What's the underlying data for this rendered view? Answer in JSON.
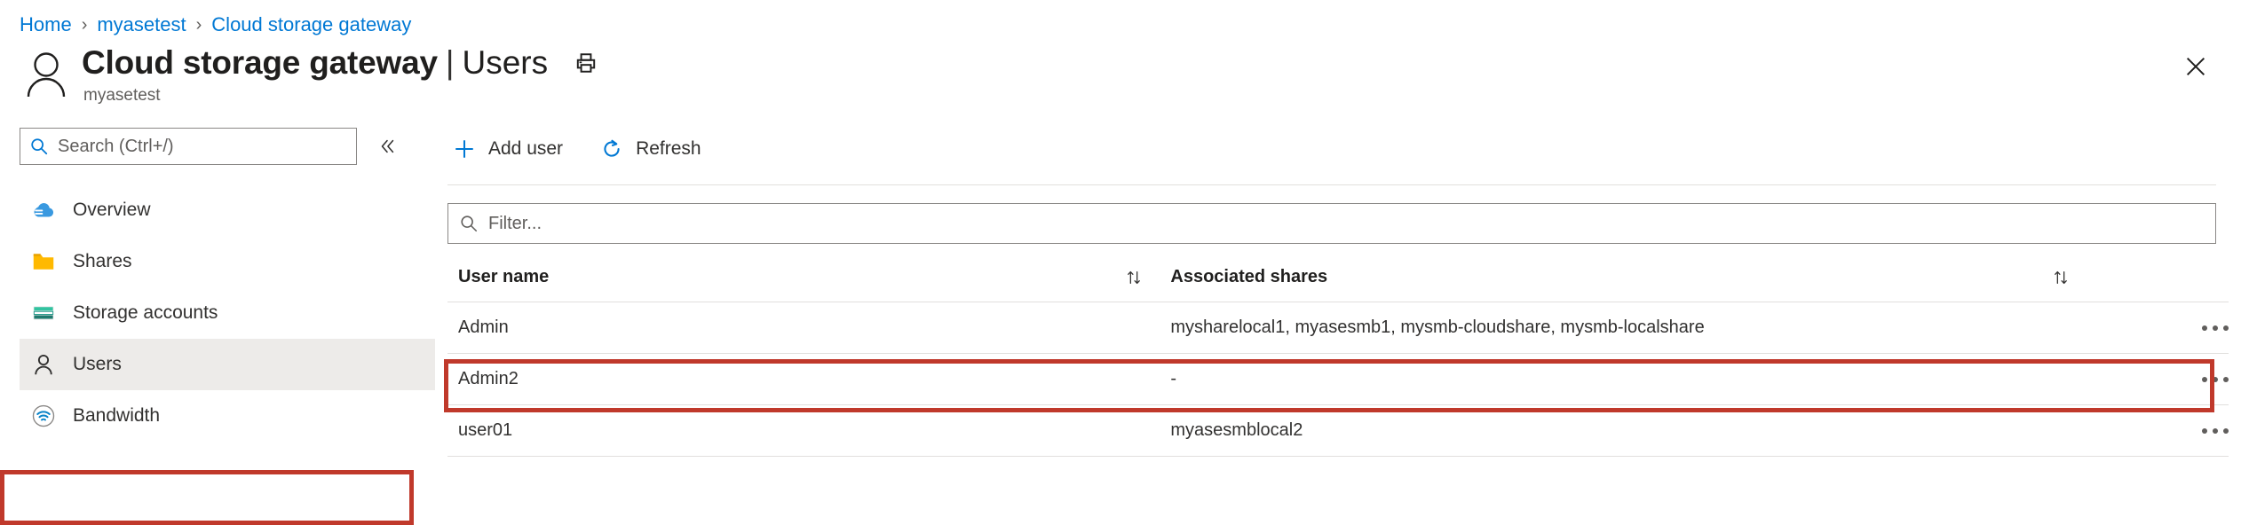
{
  "breadcrumb": {
    "items": [
      {
        "label": "Home"
      },
      {
        "label": "myasetest"
      },
      {
        "label": "Cloud storage gateway"
      }
    ],
    "separator": "›"
  },
  "header": {
    "resource_icon": "person-icon",
    "title": "Cloud storage gateway",
    "title_separator": "|",
    "section": "Users",
    "subtitle": "myasetest",
    "print_icon": "printer-icon",
    "close_icon": "close-icon"
  },
  "sidebar": {
    "search": {
      "placeholder": "Search (Ctrl+/)",
      "value": "",
      "icon": "search-icon"
    },
    "collapse_icon": "chevron-double-left-icon",
    "items": [
      {
        "label": "Overview",
        "icon": "cloud-icon",
        "selected": false
      },
      {
        "label": "Shares",
        "icon": "folder-icon",
        "selected": false
      },
      {
        "label": "Storage accounts",
        "icon": "storage-icon",
        "selected": false
      },
      {
        "label": "Users",
        "icon": "person-icon",
        "selected": true
      },
      {
        "label": "Bandwidth",
        "icon": "bandwidth-icon",
        "selected": false
      }
    ]
  },
  "toolbar": {
    "buttons": [
      {
        "label": "Add user",
        "icon": "plus-icon"
      },
      {
        "label": "Refresh",
        "icon": "refresh-icon"
      }
    ]
  },
  "filter": {
    "placeholder": "Filter...",
    "value": "",
    "icon": "search-icon"
  },
  "table": {
    "columns": [
      {
        "label": "User name",
        "sort_icon": "sort-updown-icon"
      },
      {
        "label": "Associated shares",
        "sort_icon": "sort-updown-icon"
      },
      {
        "label": ""
      }
    ],
    "rows": [
      {
        "user_name": "Admin",
        "associated_shares": "mysharelocal1, myasesmb1, mysmb-cloudshare, mysmb-localshare",
        "menu_icon": "ellipsis-icon"
      },
      {
        "user_name": "Admin2",
        "associated_shares": "-",
        "menu_icon": "ellipsis-icon"
      },
      {
        "user_name": "user01",
        "associated_shares": "myasesmblocal2",
        "menu_icon": "ellipsis-icon"
      }
    ]
  },
  "annotations": {
    "highlight_color": "#c0392b",
    "regions": [
      {
        "target": "sidebar-item-users"
      },
      {
        "target": "table-row-admin2"
      }
    ]
  },
  "colors": {
    "link": "#0078d4",
    "accent": "#0078d4",
    "selected_bg": "#edebe9",
    "border": "#e1dfdd",
    "annotation": "#c0392b"
  }
}
